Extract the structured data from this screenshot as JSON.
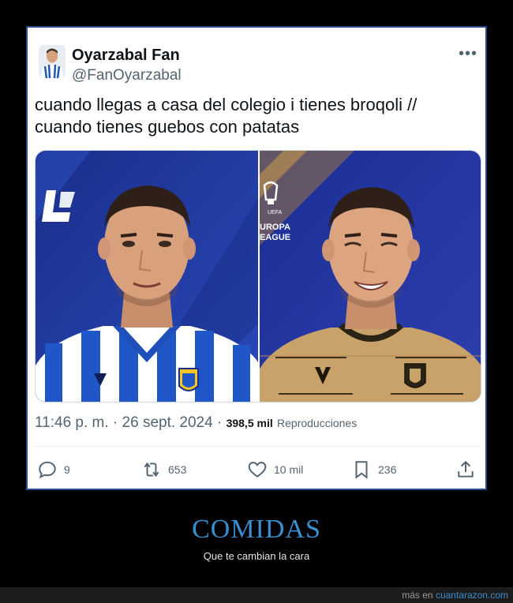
{
  "tweet": {
    "display_name": "Oyarzabal Fan",
    "handle": "@FanOyarzabal",
    "more_label": "•••",
    "text_line1": "cuando llegas a casa del colegio i tienes broqoli //",
    "text_line2": "cuando tienes guebos con patatas",
    "timestamp": "11:46 p. m. · 26 sept. 2024 · ",
    "views_count": "398,5 mil",
    "views_label": "Reproducciones",
    "media": {
      "left_logo": "LaLiga-logo",
      "right_logo_line1": "UEFA",
      "right_logo_line2": "UROPA",
      "right_logo_line3": "EAGUE"
    },
    "actions": {
      "replies": "9",
      "retweets": "653",
      "likes": "10 mil",
      "bookmarks": "236"
    }
  },
  "footer": {
    "category": "COMIDAS",
    "caption": "Que te cambian la cara",
    "source_prefix": "más en ",
    "source_link": "cuantarazon.com"
  },
  "colors": {
    "card_border": "#2b4a8a",
    "text": "#0f1419",
    "muted": "#536471",
    "footer_accent": "#3a8fd0"
  }
}
